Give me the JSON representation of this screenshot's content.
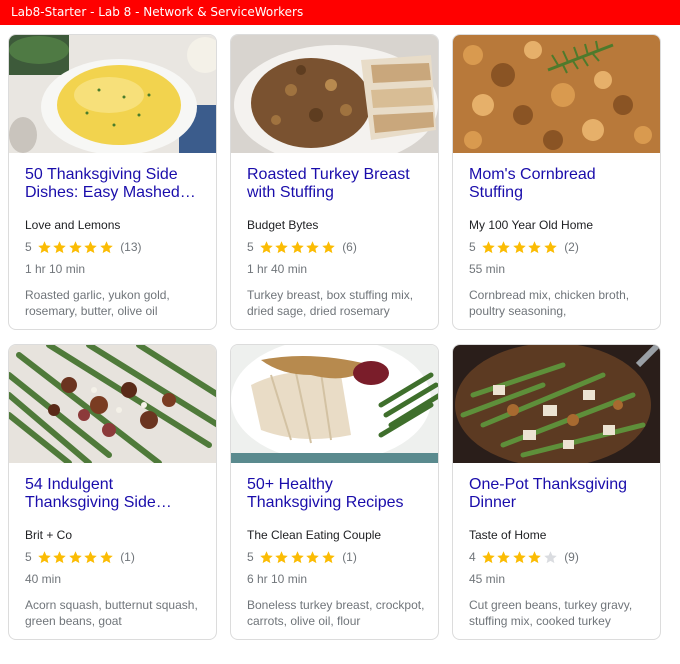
{
  "window": {
    "title": "Lab8-Starter - Lab 8 - Network & ServiceWorkers"
  },
  "colors": {
    "titlebar": "#ff0000",
    "link": "#1a0dab",
    "star_filled": "#fbbc04",
    "star_empty": "#dadce0"
  },
  "recipes": [
    {
      "title": "50 Thanksgiving Side Dishes: Easy Mashed…",
      "source": "Love and Lemons",
      "rating": 5,
      "reviews": "(13)",
      "time": "1 hr 10 min",
      "ingredients": "Roasted garlic, yukon gold, rosemary, butter, olive oil",
      "image_icon": "mashed-potatoes-image"
    },
    {
      "title": "Roasted Turkey Breast with Stuffing",
      "source": "Budget Bytes",
      "rating": 5,
      "reviews": "(6)",
      "time": "1 hr 40 min",
      "ingredients": "Turkey breast, box stuffing mix, dried sage, dried rosemary",
      "image_icon": "turkey-stuffing-image"
    },
    {
      "title": "Mom's Cornbread Stuffing",
      "source": "My 100 Year Old Home",
      "rating": 5,
      "reviews": "(2)",
      "time": "55 min",
      "ingredients": "Cornbread mix, chicken broth, poultry seasoning,",
      "image_icon": "cornbread-stuffing-image"
    },
    {
      "title": "54 Indulgent Thanksgiving Side…",
      "source": "Brit + Co",
      "rating": 5,
      "reviews": "(1)",
      "time": "40 min",
      "ingredients": "Acorn squash, butternut squash, green beans, goat",
      "image_icon": "green-beans-pecans-image"
    },
    {
      "title": "50+ Healthy Thanksgiving Recipes",
      "source": "The Clean Eating Couple",
      "rating": 5,
      "reviews": "(1)",
      "time": "6 hr 10 min",
      "ingredients": "Boneless turkey breast, crockpot, carrots, olive oil, flour",
      "image_icon": "turkey-plate-image"
    },
    {
      "title": "One-Pot Thanksgiving Dinner",
      "source": "Taste of Home",
      "rating": 4,
      "reviews": "(9)",
      "time": "45 min",
      "ingredients": "Cut green beans, turkey gravy, stuffing mix, cooked turkey",
      "image_icon": "one-pot-dinner-image"
    }
  ]
}
